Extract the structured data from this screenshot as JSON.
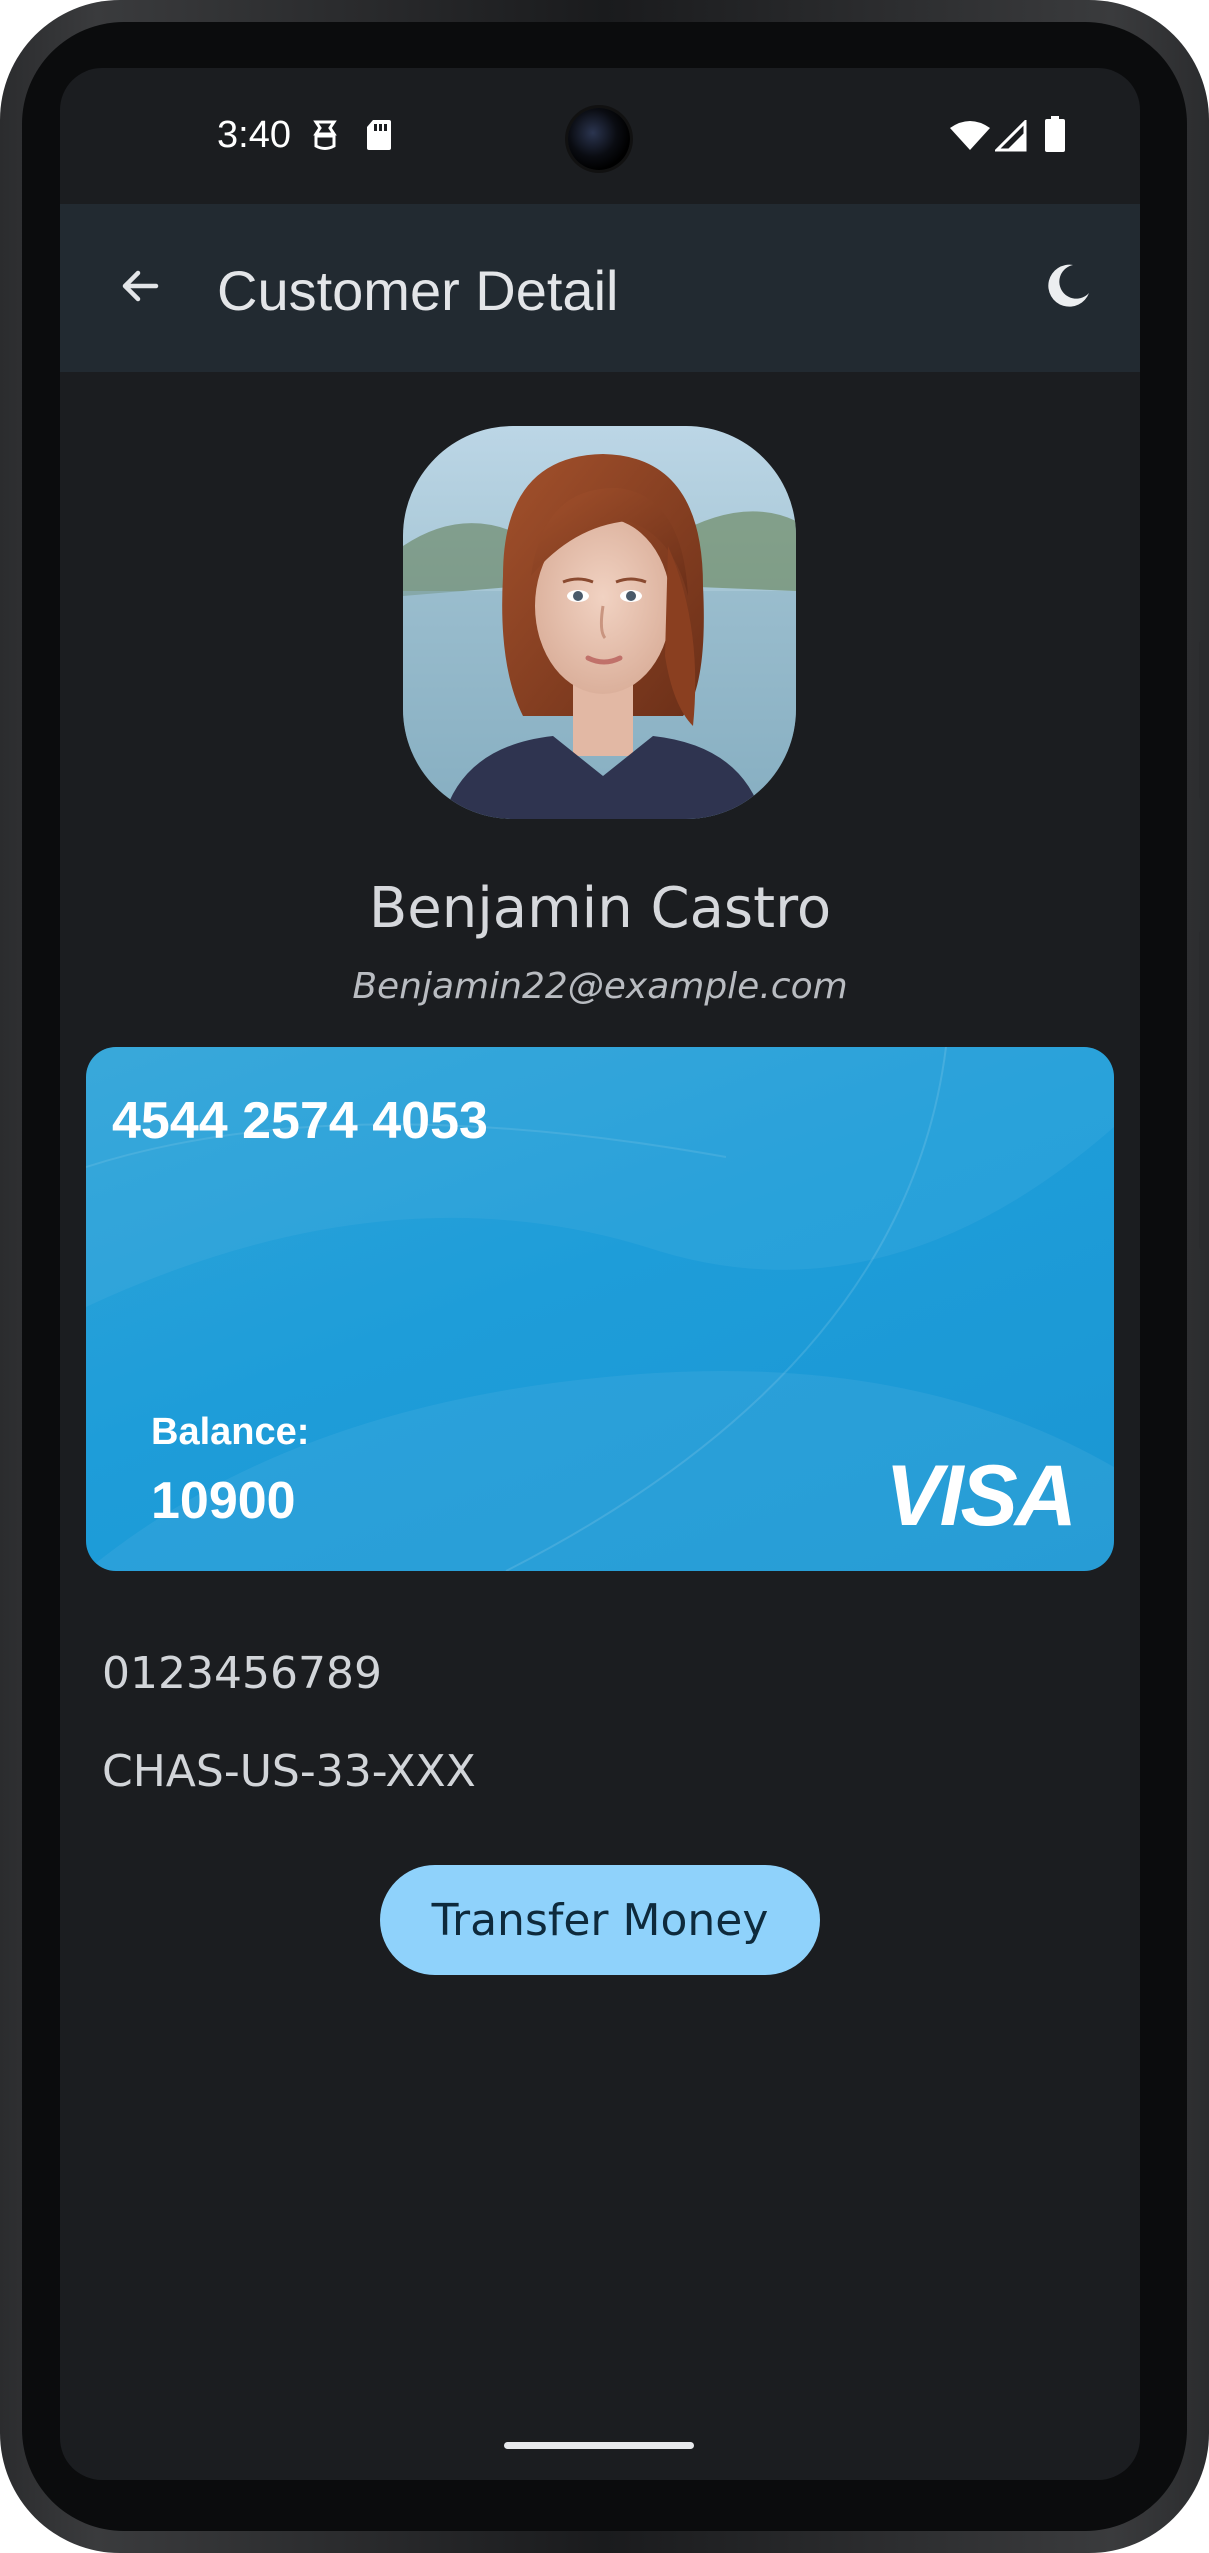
{
  "status_bar": {
    "time": "3:40"
  },
  "app_bar": {
    "title": "Customer Detail",
    "back_icon": "arrow-back-icon",
    "theme_icon": "moon-icon"
  },
  "customer": {
    "name": "Benjamin Castro",
    "email": "Benjamin22@example.com",
    "account_number": "0123456789",
    "bank_code": "CHAS-US-33-XXX"
  },
  "card": {
    "number": "4544 2574 4053",
    "balance_label": "Balance:",
    "balance_value": "10900",
    "brand": "VISA"
  },
  "actions": {
    "transfer_label": "Transfer Money"
  },
  "colors": {
    "screen_bg": "#1b1d20",
    "app_bar_bg": "#222a31",
    "card_bg": "#1e9dd9",
    "button_bg": "#8fd2fb"
  }
}
